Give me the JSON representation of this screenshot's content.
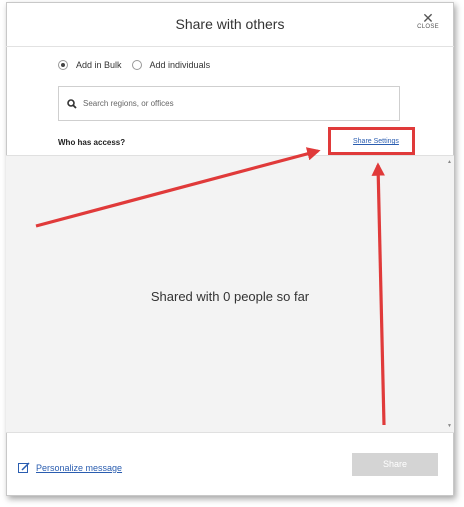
{
  "dialog": {
    "title": "Share with others",
    "close_icon": "close-icon",
    "close_label": "CLOSE"
  },
  "mode": {
    "options": [
      {
        "label": "Add in Bulk",
        "selected": true
      },
      {
        "label": "Add individuals",
        "selected": false
      }
    ]
  },
  "search": {
    "icon": "search-icon",
    "placeholder": "Search regions, or offices"
  },
  "access": {
    "label": "Who has access?",
    "settings_link": "Share Settings",
    "empty_message": "Shared with 0 people so far"
  },
  "footer": {
    "personalize_label": "Personalize message",
    "personalize_icon": "edit-icon",
    "share_label": "Share"
  },
  "colors": {
    "link": "#2a5db0",
    "annotation": "#e03a3a",
    "disabled_button": "#d4d4d4"
  }
}
